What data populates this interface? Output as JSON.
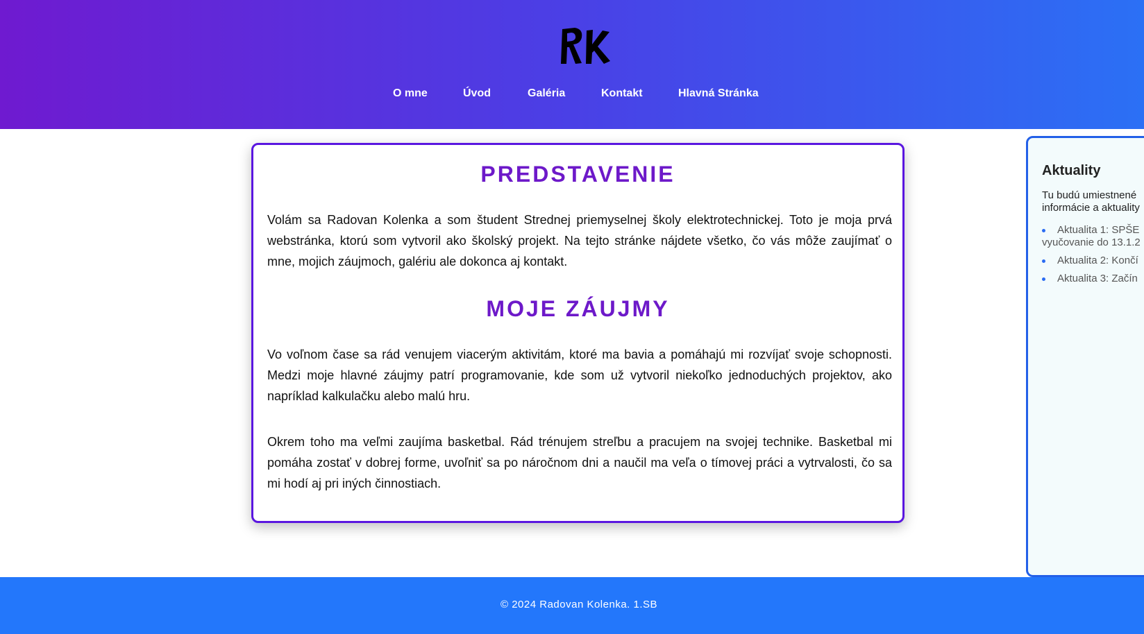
{
  "header": {
    "logo_text": "RK",
    "nav": [
      {
        "label": "O mne"
      },
      {
        "label": "Úvod"
      },
      {
        "label": "Galéria"
      },
      {
        "label": "Kontakt"
      },
      {
        "label": "Hlavná Stránka"
      }
    ]
  },
  "main": {
    "section1": {
      "title": "PREDSTAVENIE",
      "text": "Volám sa Radovan Kolenka a som študent Strednej priemyselnej školy elektrotechnickej. Toto je moja prvá webstránka, ktorú som vytvoril ako školský projekt. Na tejto stránke nájdete všetko, čo vás môže zaujímať o mne, mojich záujmoch, galériu ale dokonca aj kontakt."
    },
    "section2": {
      "title": "MOJE ZÁUJMY",
      "text1": "Vo voľnom čase sa rád venujem viacerým aktivitám, ktoré ma bavia a pomáhajú mi rozvíjať svoje schopnosti. Medzi moje hlavné záujmy patrí programovanie, kde som už vytvoril niekoľko jednoduchých projektov, ako napríklad kalkulačku alebo malú hru.",
      "text2": "Okrem toho ma veľmi zaujíma basketbal. Rád trénujem streľbu a pracujem na svojej technike. Basketbal mi pomáha zostať v dobrej forme, uvoľniť sa po náročnom dni a naučil ma veľa o tímovej práci a vytrvalosti, čo sa mi hodí aj pri iných činnostiach."
    }
  },
  "sidebar": {
    "title": "Aktuality",
    "intro_line1": "Tu budú umiestnené",
    "intro_line2": "informácie a aktuality",
    "items": [
      {
        "line1": "Aktualita 1: SPŠE",
        "line2": "vyučovanie do 13.1.2"
      },
      {
        "line1": "Aktualita 2: Končí"
      },
      {
        "line1": "Aktualita 3: Začín"
      }
    ]
  },
  "footer": {
    "text": "© 2024 Radovan Kolenka. 1.SB"
  },
  "colors": {
    "header_gradient_start": "#6f1ad0",
    "header_gradient_end": "#2b70f5",
    "title_purple": "#6d19c9",
    "box_border": "#5a16e0",
    "sidebar_border": "#2360e8",
    "footer_blue": "#2377fb"
  }
}
